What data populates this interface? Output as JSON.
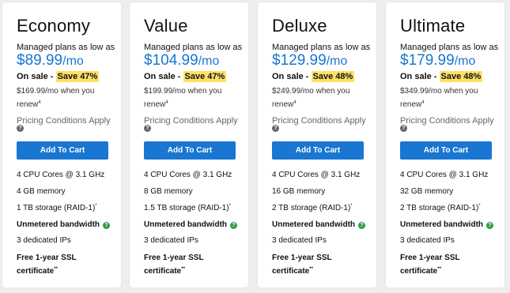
{
  "plans": [
    {
      "name": "Economy",
      "intro": "Managed plans as low as",
      "price": "$89.99",
      "period": "/mo",
      "sale_prefix": "On sale - ",
      "sale_badge": "Save 47%",
      "renew_text": "$169.99/mo when you renew",
      "renew_sup": "4",
      "pricing_conditions": "Pricing Conditions Apply",
      "info_glyph": "?",
      "button": "Add To Cart",
      "features": {
        "cpu": "4 CPU Cores @ 3.1 GHz",
        "memory": "4 GB memory",
        "storage": "1 TB storage (RAID-1)",
        "storage_sup": "*",
        "bandwidth": "Unmetered bandwidth",
        "bandwidth_glyph": "?",
        "ips": "3 dedicated IPs",
        "ssl": "Free 1-year SSL certificate",
        "ssl_sup": "**"
      }
    },
    {
      "name": "Value",
      "intro": "Managed plans as low as",
      "price": "$104.99",
      "period": "/mo",
      "sale_prefix": "On sale - ",
      "sale_badge": "Save 47%",
      "renew_text": "$199.99/mo when you renew",
      "renew_sup": "4",
      "pricing_conditions": "Pricing Conditions Apply",
      "info_glyph": "?",
      "button": "Add To Cart",
      "features": {
        "cpu": "4 CPU Cores @ 3.1 GHz",
        "memory": "8 GB memory",
        "storage": "1.5 TB storage (RAID-1)",
        "storage_sup": "*",
        "bandwidth": "Unmetered bandwidth",
        "bandwidth_glyph": "?",
        "ips": "3 dedicated IPs",
        "ssl": "Free 1-year SSL certificate",
        "ssl_sup": "**"
      }
    },
    {
      "name": "Deluxe",
      "intro": "Managed plans as low as",
      "price": "$129.99",
      "period": "/mo",
      "sale_prefix": "On sale - ",
      "sale_badge": "Save 48%",
      "renew_text": "$249.99/mo when you renew",
      "renew_sup": "4",
      "pricing_conditions": "Pricing Conditions Apply",
      "info_glyph": "?",
      "button": "Add To Cart",
      "features": {
        "cpu": "4 CPU Cores @ 3.1 GHz",
        "memory": "16 GB memory",
        "storage": "2 TB storage (RAID-1)",
        "storage_sup": "*",
        "bandwidth": "Unmetered bandwidth",
        "bandwidth_glyph": "?",
        "ips": "3 dedicated IPs",
        "ssl": "Free 1-year SSL certificate",
        "ssl_sup": "**"
      }
    },
    {
      "name": "Ultimate",
      "intro": "Managed plans as low as",
      "price": "$179.99",
      "period": "/mo",
      "sale_prefix": "On sale - ",
      "sale_badge": "Save 48%",
      "renew_text": "$349.99/mo when you renew",
      "renew_sup": "4",
      "pricing_conditions": "Pricing Conditions Apply",
      "info_glyph": "?",
      "button": "Add To Cart",
      "features": {
        "cpu": "4 CPU Cores @ 3.1 GHz",
        "memory": "32 GB memory",
        "storage": "2 TB storage (RAID-1)",
        "storage_sup": "*",
        "bandwidth": "Unmetered bandwidth",
        "bandwidth_glyph": "?",
        "ips": "3 dedicated IPs",
        "ssl": "Free 1-year SSL certificate",
        "ssl_sup": "**"
      }
    }
  ],
  "colors": {
    "price": "#1976d2",
    "button_bg": "#1976d2",
    "sale_highlight": "#ffe066",
    "bandwidth_icon": "#2e9e45",
    "info_icon": "#666666"
  },
  "icons": {
    "info": "question-circle-icon",
    "bandwidth_info": "green-question-circle-icon"
  }
}
